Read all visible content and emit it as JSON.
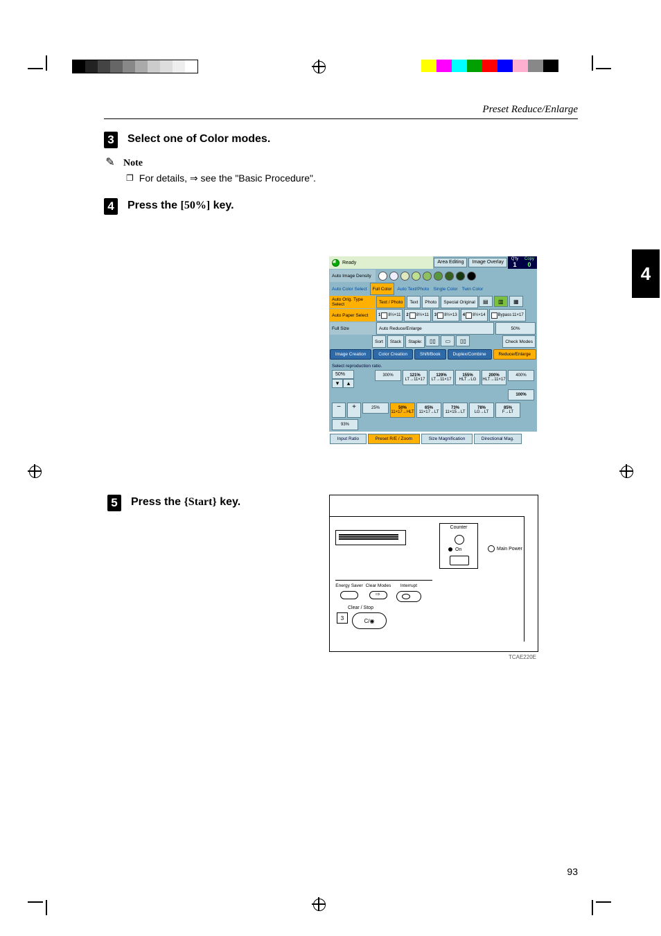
{
  "running_head": "Preset Reduce/Enlarge",
  "section_number": "4",
  "page_number": "93",
  "steps": {
    "s3": {
      "num": "3",
      "text": "Select one of Color modes."
    },
    "note": {
      "label": "Note",
      "body": "For details, ⇒ see the \"Basic Procedure\"."
    },
    "s4": {
      "num": "4",
      "text_before": "Press the ",
      "key": "[50%]",
      "text_after": " key."
    },
    "s5": {
      "num": "5",
      "text_before": "Press the ",
      "key": "{Start}",
      "text_after": " key."
    }
  },
  "panel": {
    "status": "Ready",
    "top_buttons": {
      "area_editing": "Area Editing",
      "image_overlay": "Image Overlay"
    },
    "qty": {
      "label": "Q'ty",
      "value": "1"
    },
    "copy": {
      "label": "Copy",
      "value": "0"
    },
    "rows": {
      "density_label": "Auto Image Density",
      "color_mode": {
        "label": "Auto Color Select",
        "options": [
          "Full Color",
          "Auto Text/Photo",
          "Single Color",
          "Twin Color"
        ],
        "active": "Full Color"
      },
      "orig_type": {
        "label": "Auto Orig. Type Select",
        "options": [
          "Text / Photo",
          "Text",
          "Photo",
          "Special Original"
        ],
        "active": "Text / Photo"
      },
      "paper": {
        "label": "Auto Paper Select",
        "trays": [
          {
            "n": "1",
            "size": "8½×11"
          },
          {
            "n": "2",
            "size": "8½×11"
          },
          {
            "n": "3",
            "size": "8½×13"
          },
          {
            "n": "4",
            "size": "8½×14"
          },
          {
            "n": "",
            "size": "11×17",
            "bypass": "Bypass"
          }
        ]
      },
      "size": {
        "label": "Full Size",
        "auto": "Auto Reduce/Enlarge",
        "pct": "50%"
      },
      "finish": {
        "sort": "Sort",
        "stack": "Stack",
        "staple": "Staple:",
        "check": "Check Modes"
      }
    },
    "modes": {
      "items": [
        "Image Creation",
        "Color Creation",
        "Shift/Book",
        "Duplex/Combine",
        "Reduce/Enlarge"
      ],
      "active": "Reduce/Enlarge"
    },
    "re": {
      "hint": "Select reproduction ratio.",
      "spin_value": "50%",
      "enlarge_row": [
        {
          "v": "300%"
        },
        {
          "v": "121%",
          "s": "LT→11×17"
        },
        {
          "v": "129%",
          "s": "LT→11×17"
        },
        {
          "v": "155%",
          "s": "HLT→LG"
        },
        {
          "v": "200%",
          "s": "HLT→11×17"
        },
        {
          "v": "400%"
        }
      ],
      "neutral": "100%",
      "reduce_row": [
        {
          "v": "25%"
        },
        {
          "v": "50%",
          "s": "11×17→HLT",
          "active": true
        },
        {
          "v": "65%",
          "s": "11×17→LT"
        },
        {
          "v": "73%",
          "s": "11×15→LT"
        },
        {
          "v": "78%",
          "s": "LG→LT"
        },
        {
          "v": "85%",
          "s": "F→LT"
        },
        {
          "v": "93%"
        }
      ],
      "minus": "−",
      "plus": "+"
    },
    "bottom": {
      "items": [
        "Input Ratio",
        "Preset R/E / Zoom",
        "Size Magnification",
        "Directional Mag."
      ],
      "active": "Preset R/E / Zoom"
    }
  },
  "hw": {
    "counter": "Counter",
    "on": "On",
    "main_power": "Main Power",
    "energy": "Energy Saver",
    "clear_modes": "Clear Modes",
    "interrupt": "Interrupt",
    "clear_stop": "Clear / Stop",
    "clear_stop_glyph": "C/◉",
    "numbox": "3",
    "fig_code": "TCAE220E"
  }
}
